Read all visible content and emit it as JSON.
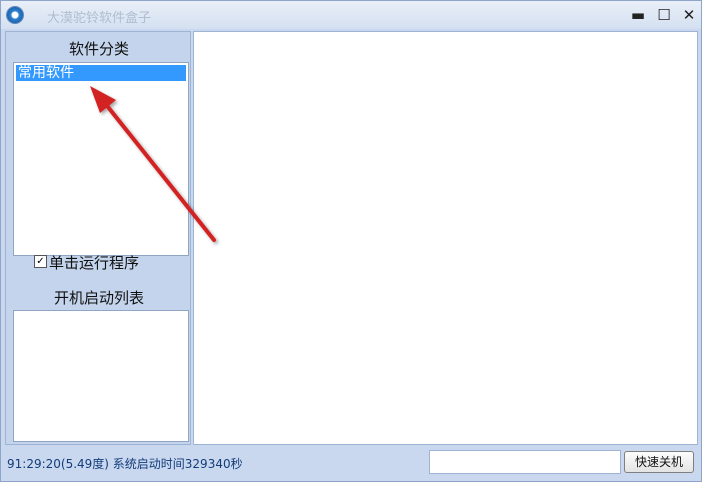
{
  "window": {
    "title": "大漠驼铃软件盒子",
    "controls": {
      "minimize": "▬",
      "maximize": "☐",
      "close": "✕"
    }
  },
  "sidebar": {
    "category_title": "软件分类",
    "categories": [
      {
        "label": "常用软件",
        "selected": true
      }
    ],
    "single_click_run": {
      "label": "单击运行程序",
      "checked": true,
      "mark": "✓"
    },
    "startup_title": "开机启动列表"
  },
  "statusbar": {
    "info": "91:29:20(5.49度)   系统启动时间329340秒",
    "shutdown_label": "快速关机"
  },
  "colors": {
    "selection": "#3399ff",
    "annotation_arrow": "#d22020"
  }
}
